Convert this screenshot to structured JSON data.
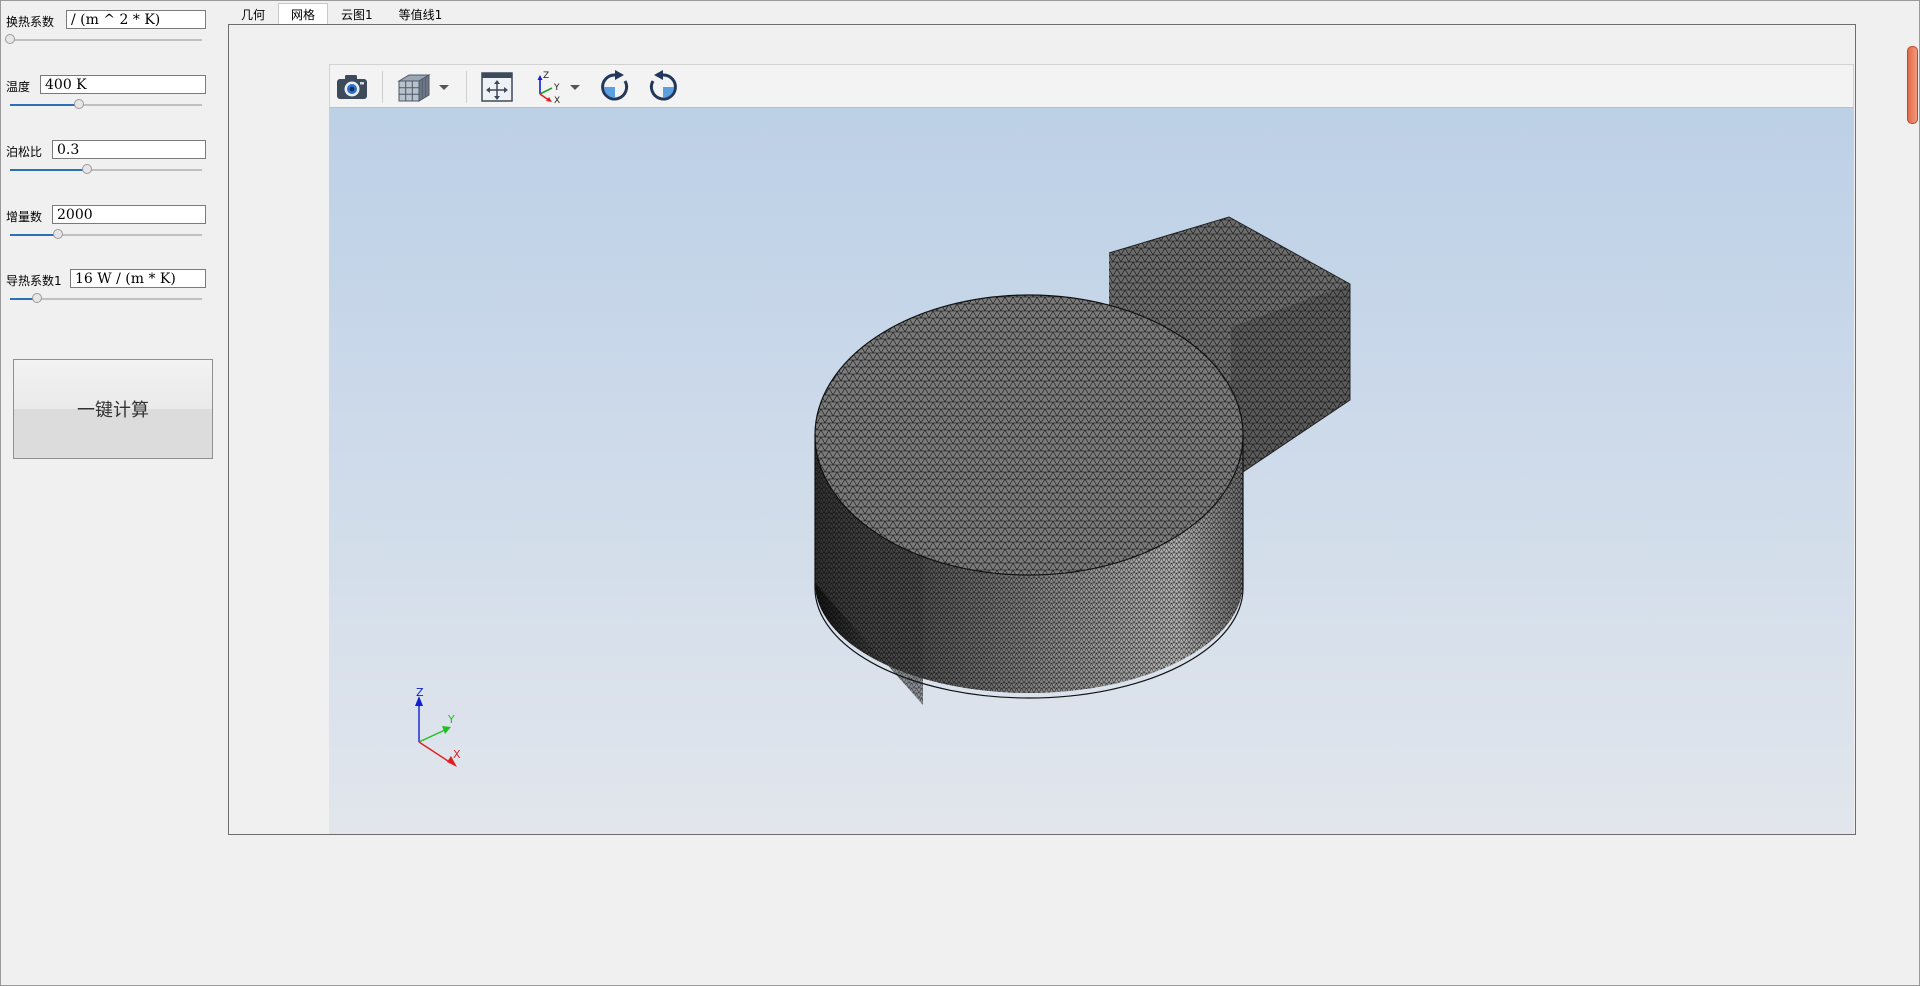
{
  "params": [
    {
      "label": "换热系数",
      "value": "/ (m ^ 2  * K)",
      "slider": 0.0
    },
    {
      "label": "温度",
      "value": "400 K",
      "slider": 0.36
    },
    {
      "label": "泊松比",
      "value": "0.3",
      "slider": 0.4
    },
    {
      "label": "增量数",
      "value": "2000",
      "slider": 0.25
    },
    {
      "label": "导热系数1",
      "value": "16 W / (m * K)",
      "slider": 0.14
    }
  ],
  "calc_button": "一键计算",
  "tabs": [
    "几何",
    "网格",
    "云图1",
    "等值线1"
  ],
  "active_tab": 1,
  "toolbar_icons": [
    "camera-icon",
    "mesh-cube-icon",
    "fit-view-icon",
    "axes-orientation-icon",
    "rotate-clockwise-icon",
    "rotate-counterclockwise-icon"
  ],
  "triad_labels": {
    "z": "Z",
    "y": "Y",
    "x": "X"
  },
  "colors": {
    "slider_fill": "#2f6fb8",
    "axis_x": "#e02020",
    "axis_y": "#20c020",
    "axis_z": "#1020d0",
    "mesh": "#3a3a3a",
    "scroll_grip": "#e36a48"
  }
}
